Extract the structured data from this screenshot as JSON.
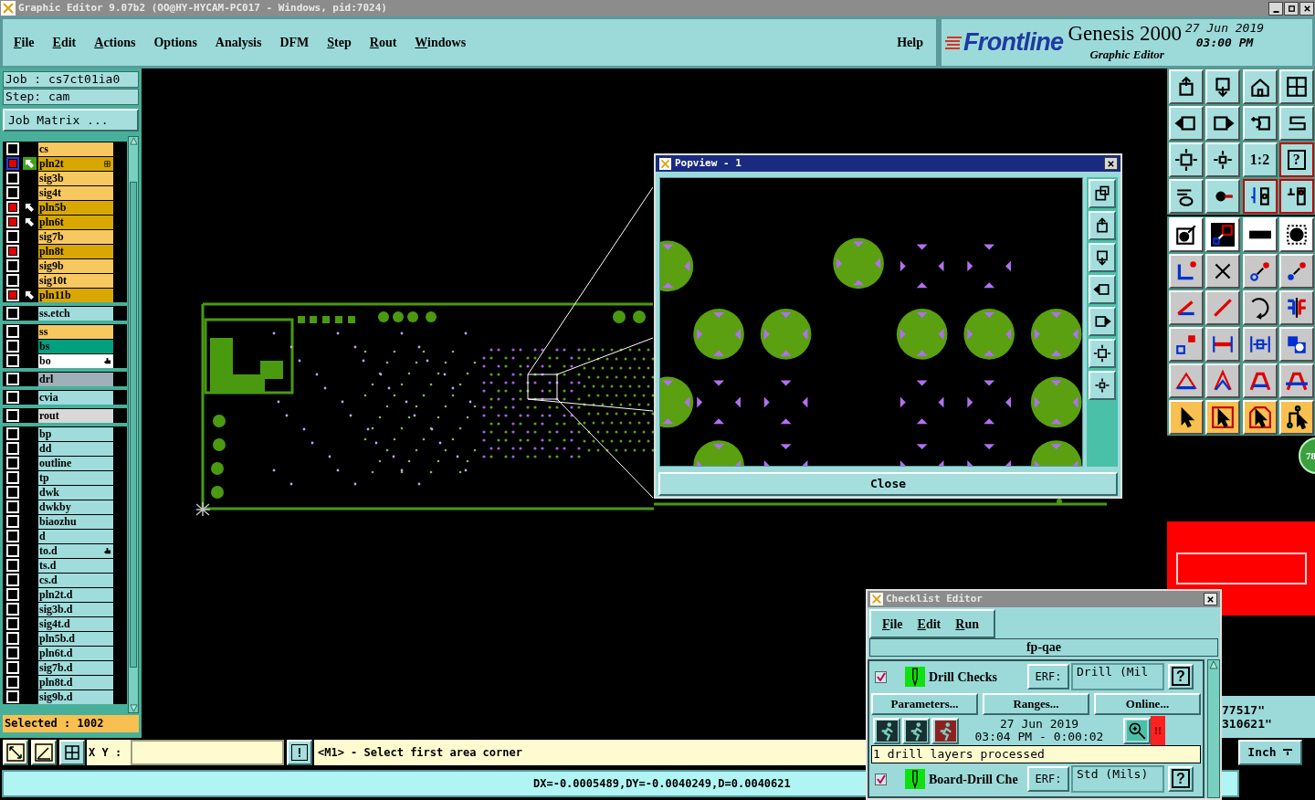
{
  "title_bar": {
    "title": "Graphic Editor 9.07b2 (OO@HY-HYCAM-PC017 - Windows, pid:7024)"
  },
  "menu": [
    {
      "label": "File",
      "mnemonic": true
    },
    {
      "label": "Edit",
      "mnemonic": true
    },
    {
      "label": "Actions",
      "mnemonic": true
    },
    {
      "label": "Options",
      "mnemonic": false
    },
    {
      "label": "Analysis",
      "mnemonic": false
    },
    {
      "label": "DFM",
      "mnemonic": false
    },
    {
      "label": "Step",
      "mnemonic": true
    },
    {
      "label": "Rout",
      "mnemonic": true
    },
    {
      "label": "Windows",
      "mnemonic": true
    }
  ],
  "help": "Help",
  "header": {
    "brand": "Frontline",
    "product": "Genesis 2000",
    "subtitle": "Graphic Editor",
    "date": "27 Jun 2019",
    "time": "03:00 PM"
  },
  "job_panel": {
    "job": "Job : cs7ct01ia0",
    "step": "Step: cam",
    "matrix_button": "Job Matrix ...",
    "selected_count": "Selected : 1002",
    "groups": [
      [
        {
          "name": "cs",
          "color": "#f8c860",
          "checked": false,
          "selected": false,
          "affected": false
        },
        {
          "name": "pln2t",
          "color": "#d8a800",
          "checked": true,
          "selected": true,
          "affected": true,
          "kind": "grid"
        },
        {
          "name": "sig3b",
          "color": "#f8c860",
          "checked": false,
          "selected": false,
          "affected": false
        },
        {
          "name": "sig4t",
          "color": "#f8c860",
          "checked": false,
          "selected": false,
          "affected": false
        },
        {
          "name": "pln5b",
          "color": "#d8a800",
          "checked": true,
          "selected": false,
          "affected": true
        },
        {
          "name": "pln6t",
          "color": "#d8a800",
          "checked": true,
          "selected": false,
          "affected": true
        },
        {
          "name": "sig7b",
          "color": "#f8c860",
          "checked": false,
          "selected": false,
          "affected": false
        },
        {
          "name": "pln8t",
          "color": "#d8a800",
          "checked": true,
          "selected": false,
          "affected": false
        },
        {
          "name": "sig9b",
          "color": "#f8c860",
          "checked": false,
          "selected": false,
          "affected": false
        },
        {
          "name": "sig10t",
          "color": "#f8c860",
          "checked": false,
          "selected": false,
          "affected": false
        },
        {
          "name": "pln11b",
          "color": "#d8a800",
          "checked": true,
          "selected": false,
          "affected": true
        }
      ],
      [
        {
          "name": "ss.etch",
          "color": "#a0dcdc",
          "checked": false,
          "selected": false,
          "affected": false
        }
      ],
      [
        {
          "name": "ss",
          "color": "#f8c860",
          "checked": false,
          "selected": false,
          "affected": false
        },
        {
          "name": "bs",
          "color": "#00a080",
          "checked": false,
          "selected": false,
          "affected": false
        },
        {
          "name": "bo",
          "color": "#ffffff",
          "checked": false,
          "selected": false,
          "affected": false,
          "kind": "hand"
        }
      ],
      [
        {
          "name": "drl",
          "color": "#a0b0b8",
          "checked": false,
          "selected": false,
          "affected": false
        }
      ],
      [
        {
          "name": "cvia",
          "color": "#a0dcdc",
          "checked": false,
          "selected": false,
          "affected": false
        }
      ],
      [
        {
          "name": "rout",
          "color": "#d8d8d8",
          "checked": false,
          "selected": false,
          "affected": false
        }
      ],
      [
        {
          "name": "bp",
          "color": "#a0dcdc",
          "checked": false,
          "selected": false,
          "affected": false
        },
        {
          "name": "dd",
          "color": "#a0dcdc",
          "checked": false,
          "selected": false,
          "affected": false
        },
        {
          "name": "outline",
          "color": "#a0dcdc",
          "checked": false,
          "selected": false,
          "affected": false
        },
        {
          "name": "tp",
          "color": "#a0dcdc",
          "checked": false,
          "selected": false,
          "affected": false
        },
        {
          "name": "dwk",
          "color": "#a0dcdc",
          "checked": false,
          "selected": false,
          "affected": false
        },
        {
          "name": "dwkby",
          "color": "#a0dcdc",
          "checked": false,
          "selected": false,
          "affected": false
        },
        {
          "name": "biaozhu",
          "color": "#a0dcdc",
          "checked": false,
          "selected": false,
          "affected": false
        },
        {
          "name": "d",
          "color": "#a0dcdc",
          "checked": false,
          "selected": false,
          "affected": false
        },
        {
          "name": "to.d",
          "color": "#a0dcdc",
          "checked": false,
          "selected": false,
          "affected": false,
          "kind": "hand"
        },
        {
          "name": "ts.d",
          "color": "#a0dcdc",
          "checked": false,
          "selected": false,
          "affected": false
        },
        {
          "name": "cs.d",
          "color": "#a0dcdc",
          "checked": false,
          "selected": false,
          "affected": false
        },
        {
          "name": "pln2t.d",
          "color": "#a0dcdc",
          "checked": false,
          "selected": false,
          "affected": false
        },
        {
          "name": "sig3b.d",
          "color": "#a0dcdc",
          "checked": false,
          "selected": false,
          "affected": false
        },
        {
          "name": "sig4t.d",
          "color": "#a0dcdc",
          "checked": false,
          "selected": false,
          "affected": false
        },
        {
          "name": "pln5b.d",
          "color": "#a0dcdc",
          "checked": false,
          "selected": false,
          "affected": false
        },
        {
          "name": "pln6t.d",
          "color": "#a0dcdc",
          "checked": false,
          "selected": false,
          "affected": false
        },
        {
          "name": "sig7b.d",
          "color": "#a0dcdc",
          "checked": false,
          "selected": false,
          "affected": false
        },
        {
          "name": "pln8t.d",
          "color": "#a0dcdc",
          "checked": false,
          "selected": false,
          "affected": false
        },
        {
          "name": "sig9b.d",
          "color": "#a0dcdc",
          "checked": false,
          "selected": false,
          "affected": false
        }
      ]
    ]
  },
  "right_toolbar": {
    "ratio_label": "1:2",
    "help_label": "?"
  },
  "right_panel": {
    "badge": "78",
    "readouts": [
      "77517\"",
      "310621\""
    ],
    "units": "Inch"
  },
  "popview": {
    "title": "Popview - 1",
    "close": "Close"
  },
  "checklist_editor": {
    "title": "Checklist Editor",
    "menu": [
      "File",
      "Edit",
      "Run"
    ],
    "checklist": "fp-qae",
    "actions": [
      {
        "name": "Drill Checks",
        "checked": true,
        "erf_label": "ERF:",
        "erf": "Drill (Mil",
        "help": "?",
        "buttons": [
          "Parameters...",
          "Ranges...",
          "Online..."
        ],
        "date": "27 Jun 2019",
        "time": "03:04 PM - 0:00:02",
        "alert": "!!",
        "message": "1 drill layers processed"
      },
      {
        "name": "Board-Drill Che",
        "checked": true,
        "erf_label": "ERF:",
        "erf": "Std (Mils)",
        "help": "?"
      }
    ]
  },
  "command_bar": {
    "xy_label": "X Y :",
    "alert": "!",
    "prompt": "<M1> - Select first area corner"
  },
  "status_bar": {
    "measurement": "DX=-0.0005489,DY=-0.0040249,D=0.0040621"
  }
}
